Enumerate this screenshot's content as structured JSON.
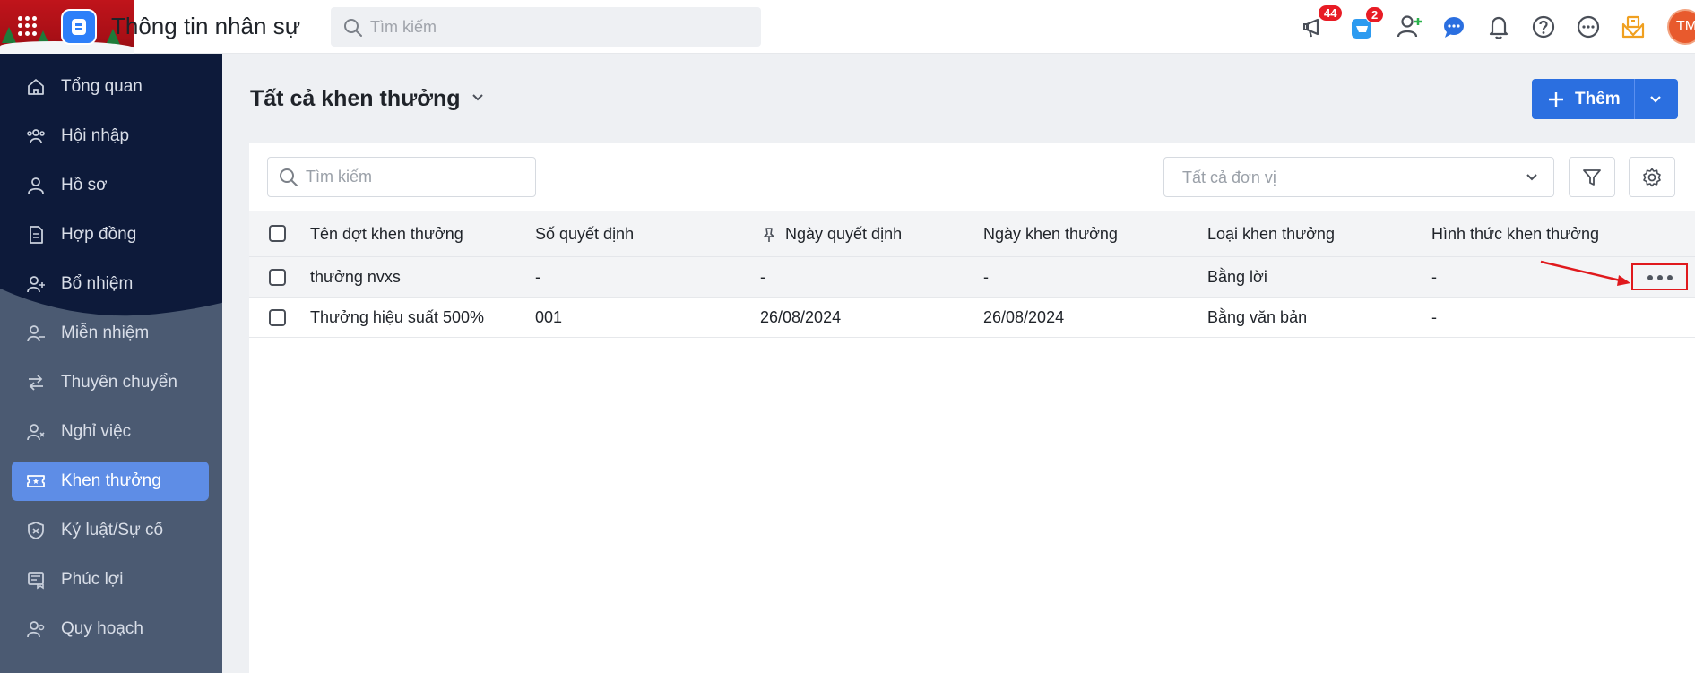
{
  "app": {
    "title": "Thông tin nhân sự",
    "search_placeholder": "Tìm kiếm",
    "notifications": {
      "announcements_badge": "44",
      "store_badge": "2"
    },
    "avatar_initials": "TM"
  },
  "sidebar": {
    "items": [
      {
        "label": "Tổng quan",
        "icon": "home-icon"
      },
      {
        "label": "Hội nhập",
        "icon": "onboarding-icon"
      },
      {
        "label": "Hồ sơ",
        "icon": "profile-icon"
      },
      {
        "label": "Hợp đồng",
        "icon": "contract-icon"
      },
      {
        "label": "Bổ nhiệm",
        "icon": "appoint-icon"
      },
      {
        "label": "Miễn nhiệm",
        "icon": "dismiss-icon"
      },
      {
        "label": "Thuyên chuyển",
        "icon": "transfer-icon"
      },
      {
        "label": "Nghỉ việc",
        "icon": "resign-icon"
      },
      {
        "label": "Khen thưởng",
        "icon": "reward-icon",
        "active": true
      },
      {
        "label": "Kỷ luật/Sự cố",
        "icon": "discipline-icon"
      },
      {
        "label": "Phúc lợi",
        "icon": "welfare-icon"
      },
      {
        "label": "Quy hoạch",
        "icon": "planning-icon"
      }
    ]
  },
  "page": {
    "title": "Tất cả khen thưởng",
    "add_button": "Thêm",
    "table_search_placeholder": "Tìm kiếm",
    "unit_filter": "Tất cả đơn vị"
  },
  "table": {
    "columns": [
      "Tên đợt khen thưởng",
      "Số quyết định",
      "Ngày quyết định",
      "Ngày khen thưởng",
      "Loại khen thưởng",
      "Hình thức khen thưởng"
    ],
    "rows": [
      [
        "thưởng nvxs",
        "-",
        "-",
        "-",
        "Bằng lời",
        "-"
      ],
      [
        "Thưởng hiệu suất 500%",
        "001",
        "26/08/2024",
        "26/08/2024",
        "Bằng văn bản",
        "-"
      ]
    ]
  },
  "colors": {
    "accent": "#2b6fe0",
    "sidebar_active": "#5e8de6",
    "highlight": "#e0191d"
  }
}
